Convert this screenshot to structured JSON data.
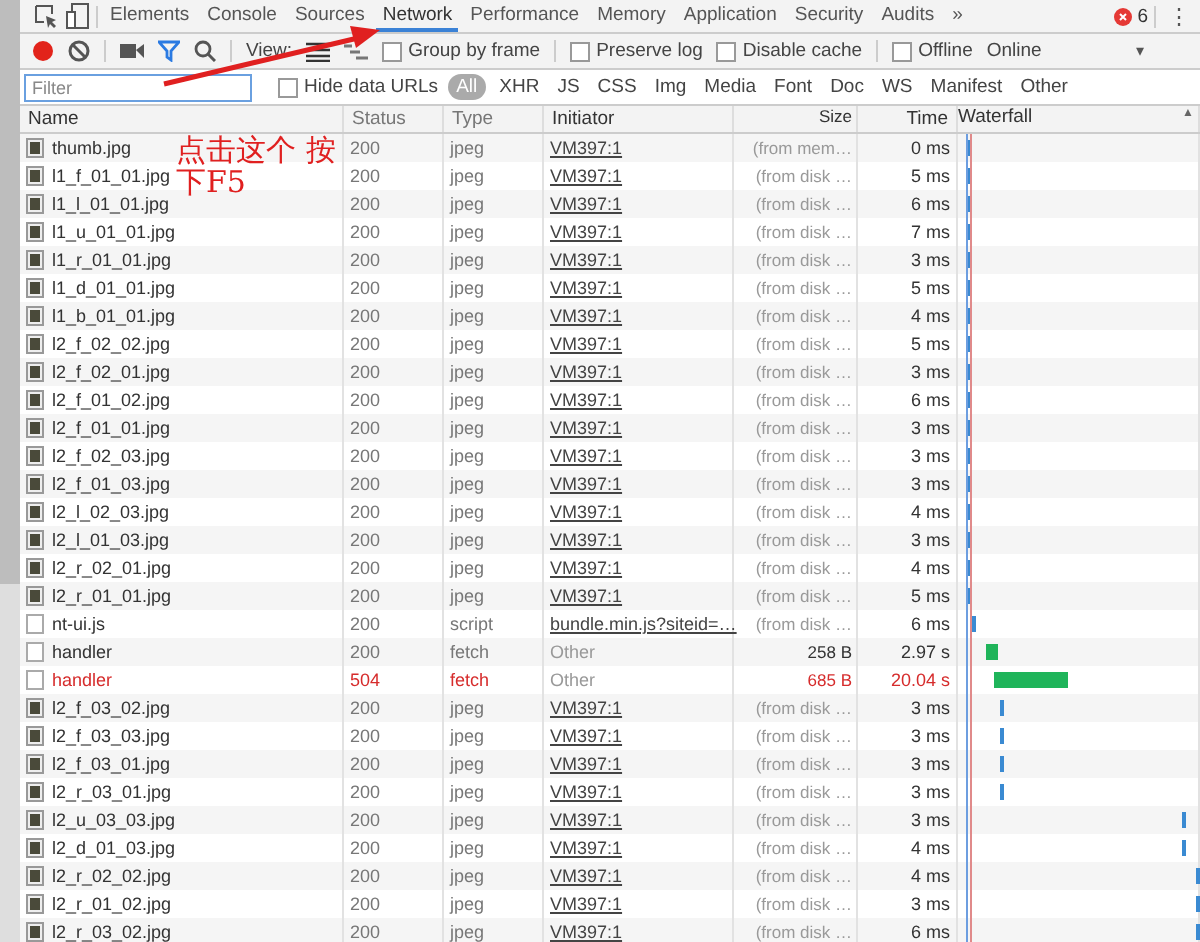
{
  "tabs": [
    {
      "label": "Elements",
      "selected": false
    },
    {
      "label": "Console",
      "selected": false
    },
    {
      "label": "Sources",
      "selected": false
    },
    {
      "label": "Network",
      "selected": true
    },
    {
      "label": "Performance",
      "selected": false
    },
    {
      "label": "Memory",
      "selected": false
    },
    {
      "label": "Application",
      "selected": false
    },
    {
      "label": "Security",
      "selected": false
    },
    {
      "label": "Audits",
      "selected": false
    }
  ],
  "overflow": "»",
  "error_count": "6",
  "menu": "⋮",
  "toolbar": {
    "recording": true,
    "filter_active": true,
    "view_label": "View:",
    "throttle": "Online",
    "caret": "▾",
    "options": [
      {
        "label": "Group by frame",
        "checked": false
      },
      {
        "label": "Preserve log",
        "checked": false
      },
      {
        "label": "Disable cache",
        "checked": false
      },
      {
        "label": "Offline",
        "checked": false
      }
    ]
  },
  "filter": {
    "placeholder": "Filter",
    "hide_data_urls": {
      "label": "Hide data URLs",
      "checked": false
    },
    "types": [
      {
        "label": "All",
        "selected": true
      },
      {
        "label": "XHR",
        "selected": false
      },
      {
        "label": "JS",
        "selected": false
      },
      {
        "label": "CSS",
        "selected": false
      },
      {
        "label": "Img",
        "selected": false
      },
      {
        "label": "Media",
        "selected": false
      },
      {
        "label": "Font",
        "selected": false
      },
      {
        "label": "Doc",
        "selected": false
      },
      {
        "label": "WS",
        "selected": false
      },
      {
        "label": "Manifest",
        "selected": false
      },
      {
        "label": "Other",
        "selected": false
      }
    ]
  },
  "columns": [
    "Name",
    "Status",
    "Type",
    "Initiator",
    "Size",
    "Time",
    "Waterfall"
  ],
  "sort_indicator": "▲",
  "rows": [
    {
      "name": "thumb.jpg",
      "status": "200",
      "type": "jpeg",
      "initiator": "VM397:1",
      "initiator_link": true,
      "size": "(from mem…",
      "from_cache": true,
      "time": "0 ms",
      "error": false
    },
    {
      "name": "l1_f_01_01.jpg",
      "status": "200",
      "type": "jpeg",
      "initiator": "VM397:1",
      "initiator_link": true,
      "size": "(from disk …",
      "from_cache": true,
      "time": "5 ms",
      "error": false
    },
    {
      "name": "l1_l_01_01.jpg",
      "status": "200",
      "type": "jpeg",
      "initiator": "VM397:1",
      "initiator_link": true,
      "size": "(from disk …",
      "from_cache": true,
      "time": "6 ms",
      "error": false
    },
    {
      "name": "l1_u_01_01.jpg",
      "status": "200",
      "type": "jpeg",
      "initiator": "VM397:1",
      "initiator_link": true,
      "size": "(from disk …",
      "from_cache": true,
      "time": "7 ms",
      "error": false
    },
    {
      "name": "l1_r_01_01.jpg",
      "status": "200",
      "type": "jpeg",
      "initiator": "VM397:1",
      "initiator_link": true,
      "size": "(from disk …",
      "from_cache": true,
      "time": "3 ms",
      "error": false
    },
    {
      "name": "l1_d_01_01.jpg",
      "status": "200",
      "type": "jpeg",
      "initiator": "VM397:1",
      "initiator_link": true,
      "size": "(from disk …",
      "from_cache": true,
      "time": "5 ms",
      "error": false
    },
    {
      "name": "l1_b_01_01.jpg",
      "status": "200",
      "type": "jpeg",
      "initiator": "VM397:1",
      "initiator_link": true,
      "size": "(from disk …",
      "from_cache": true,
      "time": "4 ms",
      "error": false
    },
    {
      "name": "l2_f_02_02.jpg",
      "status": "200",
      "type": "jpeg",
      "initiator": "VM397:1",
      "initiator_link": true,
      "size": "(from disk …",
      "from_cache": true,
      "time": "5 ms",
      "error": false
    },
    {
      "name": "l2_f_02_01.jpg",
      "status": "200",
      "type": "jpeg",
      "initiator": "VM397:1",
      "initiator_link": true,
      "size": "(from disk …",
      "from_cache": true,
      "time": "3 ms",
      "error": false
    },
    {
      "name": "l2_f_01_02.jpg",
      "status": "200",
      "type": "jpeg",
      "initiator": "VM397:1",
      "initiator_link": true,
      "size": "(from disk …",
      "from_cache": true,
      "time": "6 ms",
      "error": false
    },
    {
      "name": "l2_f_01_01.jpg",
      "status": "200",
      "type": "jpeg",
      "initiator": "VM397:1",
      "initiator_link": true,
      "size": "(from disk …",
      "from_cache": true,
      "time": "3 ms",
      "error": false
    },
    {
      "name": "l2_f_02_03.jpg",
      "status": "200",
      "type": "jpeg",
      "initiator": "VM397:1",
      "initiator_link": true,
      "size": "(from disk …",
      "from_cache": true,
      "time": "3 ms",
      "error": false
    },
    {
      "name": "l2_f_01_03.jpg",
      "status": "200",
      "type": "jpeg",
      "initiator": "VM397:1",
      "initiator_link": true,
      "size": "(from disk …",
      "from_cache": true,
      "time": "3 ms",
      "error": false
    },
    {
      "name": "l2_l_02_03.jpg",
      "status": "200",
      "type": "jpeg",
      "initiator": "VM397:1",
      "initiator_link": true,
      "size": "(from disk …",
      "from_cache": true,
      "time": "4 ms",
      "error": false
    },
    {
      "name": "l2_l_01_03.jpg",
      "status": "200",
      "type": "jpeg",
      "initiator": "VM397:1",
      "initiator_link": true,
      "size": "(from disk …",
      "from_cache": true,
      "time": "3 ms",
      "error": false
    },
    {
      "name": "l2_r_02_01.jpg",
      "status": "200",
      "type": "jpeg",
      "initiator": "VM397:1",
      "initiator_link": true,
      "size": "(from disk …",
      "from_cache": true,
      "time": "4 ms",
      "error": false
    },
    {
      "name": "l2_r_01_01.jpg",
      "status": "200",
      "type": "jpeg",
      "initiator": "VM397:1",
      "initiator_link": true,
      "size": "(from disk …",
      "from_cache": true,
      "time": "5 ms",
      "error": false
    },
    {
      "name": "nt-ui.js",
      "status": "200",
      "type": "script",
      "initiator": "bundle.min.js?siteid=…",
      "initiator_link": true,
      "size": "(from disk …",
      "from_cache": true,
      "time": "6 ms",
      "error": false
    },
    {
      "name": "handler",
      "status": "200",
      "type": "fetch",
      "initiator": "Other",
      "initiator_link": false,
      "size": "258 B",
      "from_cache": false,
      "time": "2.97 s",
      "error": false
    },
    {
      "name": "handler",
      "status": "504",
      "type": "fetch",
      "initiator": "Other",
      "initiator_link": false,
      "size": "685 B",
      "from_cache": false,
      "time": "20.04 s",
      "error": true
    },
    {
      "name": "l2_f_03_02.jpg",
      "status": "200",
      "type": "jpeg",
      "initiator": "VM397:1",
      "initiator_link": true,
      "size": "(from disk …",
      "from_cache": true,
      "time": "3 ms",
      "error": false
    },
    {
      "name": "l2_f_03_03.jpg",
      "status": "200",
      "type": "jpeg",
      "initiator": "VM397:1",
      "initiator_link": true,
      "size": "(from disk …",
      "from_cache": true,
      "time": "3 ms",
      "error": false
    },
    {
      "name": "l2_f_03_01.jpg",
      "status": "200",
      "type": "jpeg",
      "initiator": "VM397:1",
      "initiator_link": true,
      "size": "(from disk …",
      "from_cache": true,
      "time": "3 ms",
      "error": false
    },
    {
      "name": "l2_r_03_01.jpg",
      "status": "200",
      "type": "jpeg",
      "initiator": "VM397:1",
      "initiator_link": true,
      "size": "(from disk …",
      "from_cache": true,
      "time": "3 ms",
      "error": false
    },
    {
      "name": "l2_u_03_03.jpg",
      "status": "200",
      "type": "jpeg",
      "initiator": "VM397:1",
      "initiator_link": true,
      "size": "(from disk …",
      "from_cache": true,
      "time": "3 ms",
      "error": false
    },
    {
      "name": "l2_d_01_03.jpg",
      "status": "200",
      "type": "jpeg",
      "initiator": "VM397:1",
      "initiator_link": true,
      "size": "(from disk …",
      "from_cache": true,
      "time": "4 ms",
      "error": false
    },
    {
      "name": "l2_r_02_02.jpg",
      "status": "200",
      "type": "jpeg",
      "initiator": "VM397:1",
      "initiator_link": true,
      "size": "(from disk …",
      "from_cache": true,
      "time": "4 ms",
      "error": false
    },
    {
      "name": "l2_r_01_02.jpg",
      "status": "200",
      "type": "jpeg",
      "initiator": "VM397:1",
      "initiator_link": true,
      "size": "(from disk …",
      "from_cache": true,
      "time": "3 ms",
      "error": false
    },
    {
      "name": "l2_r_03_02.jpg",
      "status": "200",
      "type": "jpeg",
      "initiator": "VM397:1",
      "initiator_link": true,
      "size": "(from disk …",
      "from_cache": true,
      "time": "6 ms",
      "error": false
    }
  ],
  "annotation": {
    "text": "点击这个 按下F5"
  }
}
